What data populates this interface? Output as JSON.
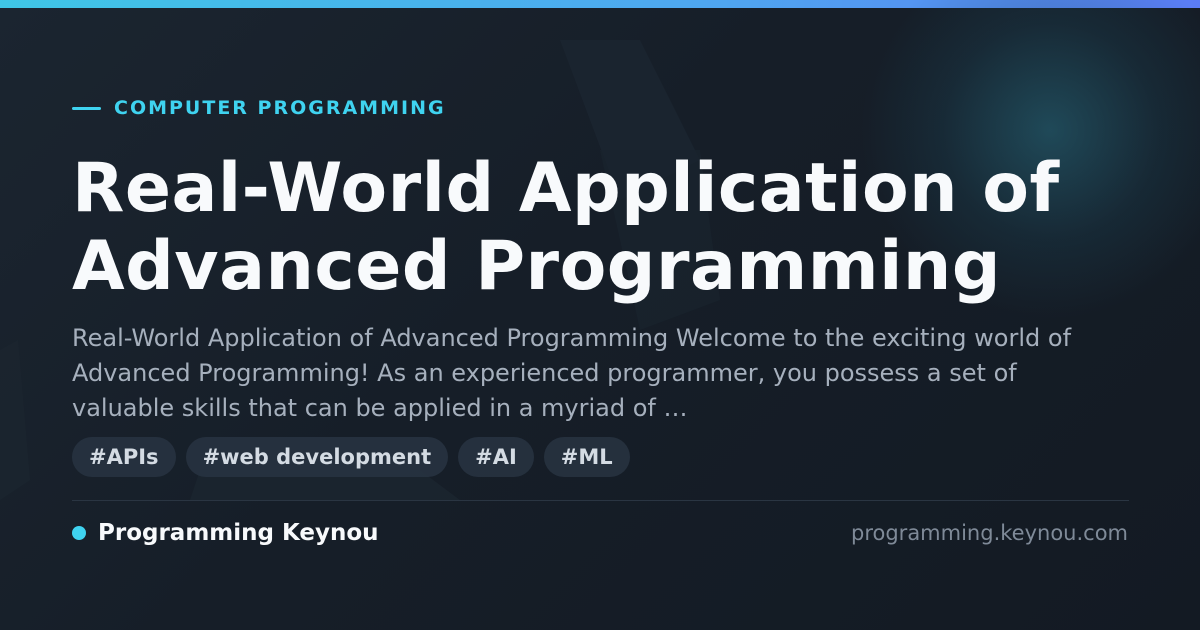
{
  "card": {
    "eyebrow": "COMPUTER PROGRAMMING",
    "title_line_1": "Real-World Application of",
    "title_line_2": "Advanced Programming",
    "description": "Real-World Application of Advanced Programming Welcome to the exciting world of Advanced Programming! As an experienced programmer, you possess a set of valuable skills that can be applied in a myriad of …",
    "tags": [
      "#APIs",
      "#web development",
      "#AI",
      "#ML"
    ],
    "brand_name": "Programming Keynou",
    "domain": "programming.keynou.com"
  },
  "colors": {
    "accent": "#3fd3f0",
    "background": "#161e28",
    "title": "#f8fafc",
    "muted": "#a6b0bd"
  },
  "icons": {
    "eyebrow_mark": "dash-icon",
    "brand_mark": "dot-icon"
  }
}
